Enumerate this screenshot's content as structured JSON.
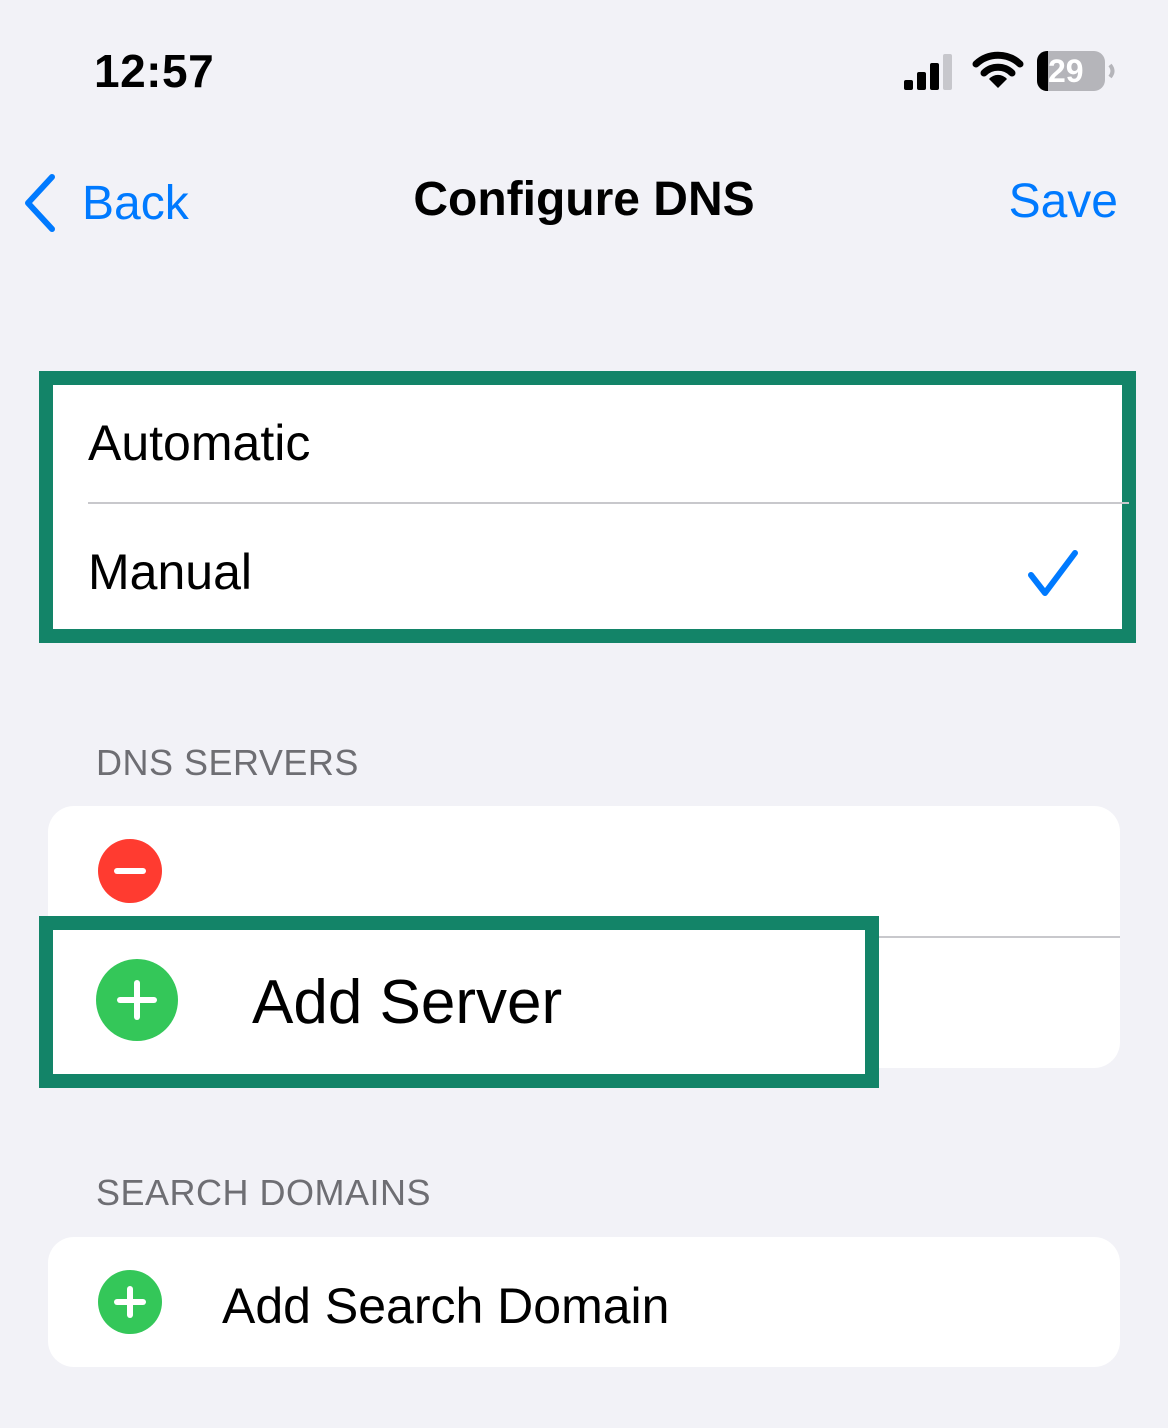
{
  "status_bar": {
    "time": "12:57",
    "battery_level": "29",
    "icons": [
      "cellular-signal-icon",
      "wifi-icon",
      "battery-icon"
    ]
  },
  "nav": {
    "back_label": "Back",
    "title": "Configure DNS",
    "save_label": "Save"
  },
  "mode": {
    "options": [
      {
        "label": "Automatic",
        "selected": false
      },
      {
        "label": "Manual",
        "selected": true
      }
    ]
  },
  "dns_servers": {
    "header": "DNS SERVERS",
    "servers": [
      ""
    ],
    "add_label": "Add Server"
  },
  "search_domains": {
    "header": "SEARCH DOMAINS",
    "add_label": "Add Search Domain"
  },
  "colors": {
    "accent": "#007aff",
    "highlight_box": "#138468",
    "remove": "#ff3b30",
    "add": "#34c759",
    "background": "#f2f2f7"
  }
}
